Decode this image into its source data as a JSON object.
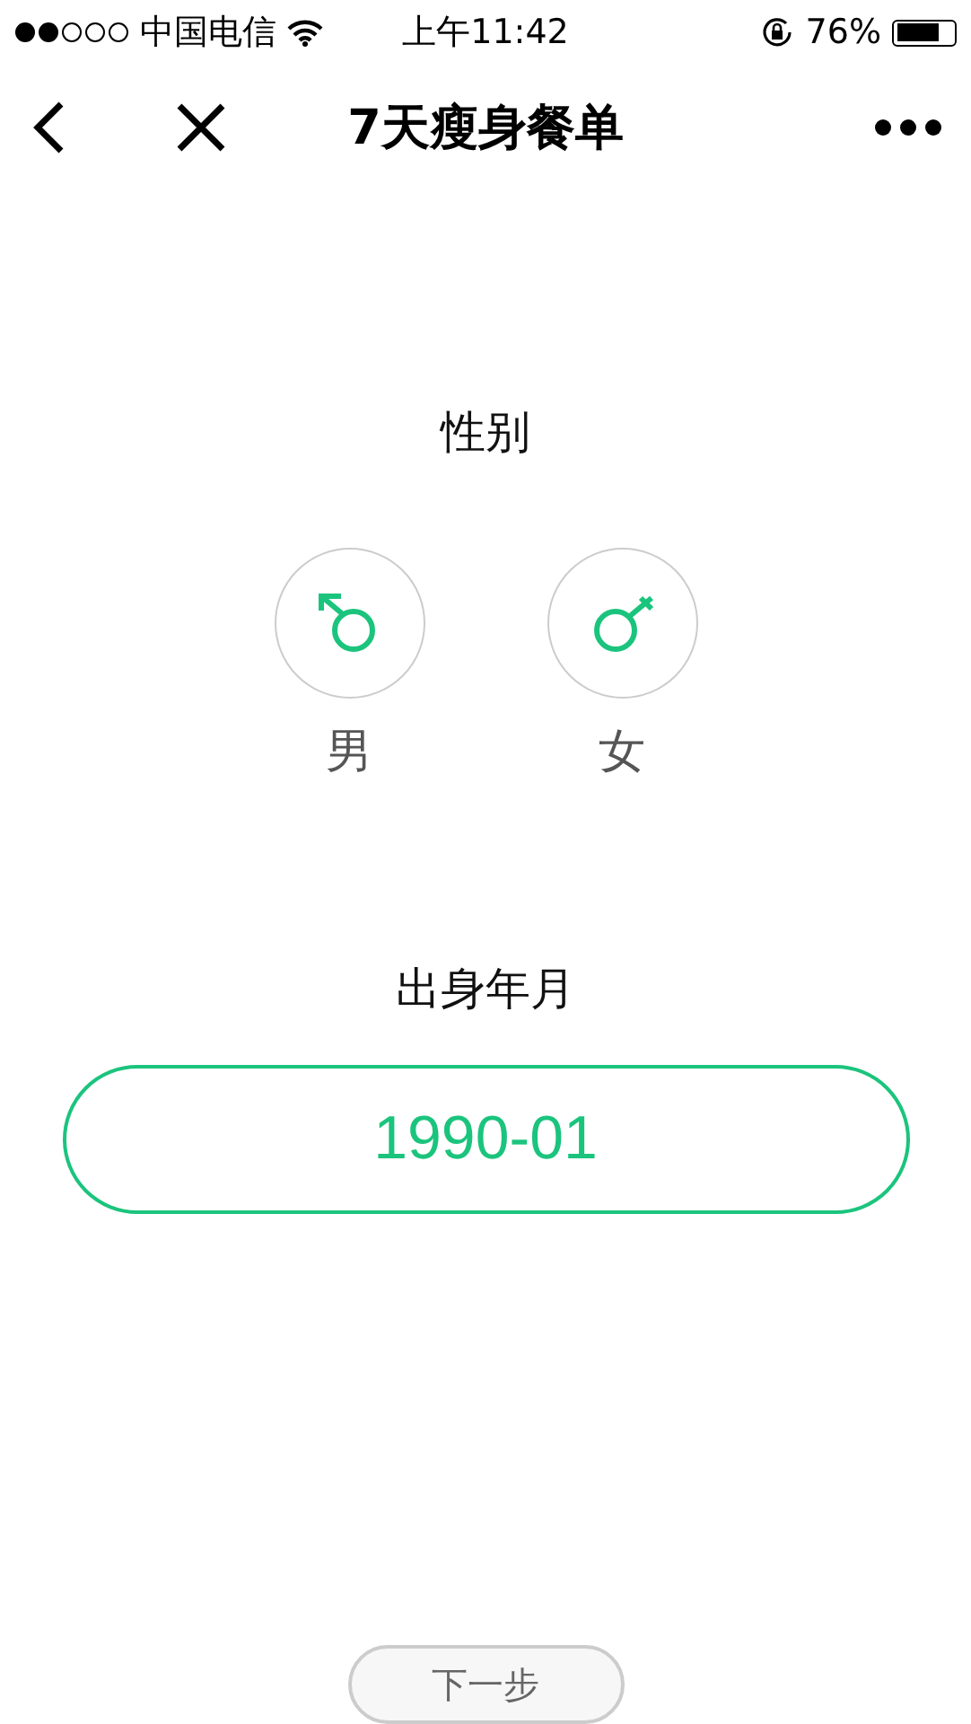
{
  "status_bar": {
    "carrier": "中国电信",
    "time": "上午11:42",
    "battery": "76%"
  },
  "nav": {
    "title": "7天瘦身餐单"
  },
  "gender": {
    "label": "性别",
    "options": [
      {
        "label": "男",
        "kind": "male",
        "selected": false
      },
      {
        "label": "女",
        "kind": "female",
        "selected": false
      }
    ]
  },
  "birth": {
    "label": "出身年月",
    "value": "1990-01"
  },
  "next_button": {
    "label": "下一步"
  }
}
